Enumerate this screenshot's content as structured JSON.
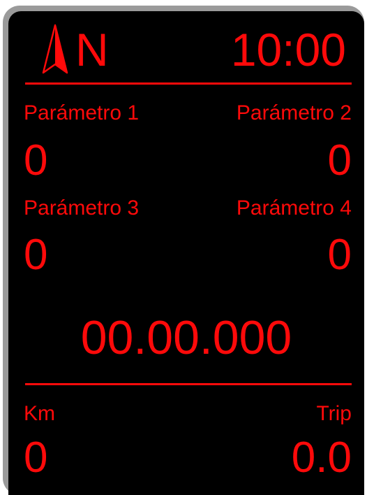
{
  "header": {
    "heading": "N",
    "time": "10:00"
  },
  "parameters": [
    {
      "label": "Parámetro 1",
      "value": "0"
    },
    {
      "label": "Parámetro 2",
      "value": "0"
    },
    {
      "label": "Parámetro 3",
      "value": "0"
    },
    {
      "label": "Parámetro 4",
      "value": "0"
    }
  ],
  "coordinate": "00.00.000",
  "footer": {
    "km_label": "Km",
    "km_value": "0",
    "trip_label": "Trip",
    "trip_value": "0.0"
  },
  "colors": {
    "accent": "#ff0a0a",
    "background": "#000000",
    "bezel": "#9a9a9a"
  },
  "icons": {
    "compass": "compass-arrow-icon"
  }
}
